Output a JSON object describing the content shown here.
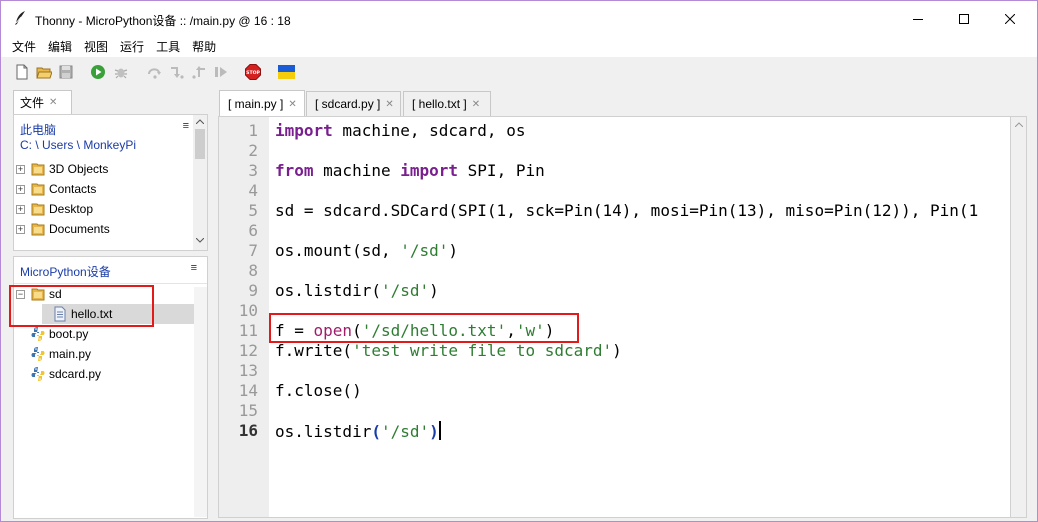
{
  "window": {
    "title": "Thonny  -  MicroPython设备 :: /main.py  @  16 : 18",
    "minimize_label": "minimize",
    "maximize_label": "maximize",
    "close_label": "close"
  },
  "menu": [
    "文件",
    "编辑",
    "视图",
    "运行",
    "工具",
    "帮助"
  ],
  "toolbar": {
    "icons": [
      "new-file-icon",
      "open-file-icon",
      "save-icon",
      "run-icon",
      "debug-icon",
      "step-over-icon",
      "step-into-icon",
      "step-out-icon",
      "resume-icon",
      "stop-icon",
      "ukraine-flag-icon"
    ]
  },
  "files_panel": {
    "tab_label": "文件",
    "this_pc": {
      "title": "此电脑",
      "path": "C: \\ Users \\ MonkeyPi",
      "items": [
        "3D Objects",
        "Contacts",
        "Desktop",
        "Documents"
      ]
    },
    "device": {
      "title": "MicroPython设备",
      "folder": "sd",
      "folder_child": "hello.txt",
      "files": [
        "boot.py",
        "main.py",
        "sdcard.py"
      ]
    }
  },
  "editor": {
    "tabs": [
      "[ main.py ]",
      "[ sdcard.py ]",
      "[ hello.txt ]"
    ],
    "line_numbers": [
      "1",
      "2",
      "3",
      "4",
      "5",
      "6",
      "7",
      "8",
      "9",
      "10",
      "11",
      "12",
      "13",
      "14",
      "15",
      "16"
    ],
    "current_line": 16,
    "code": {
      "l1_kw": "import",
      "l1_rest": " machine, sdcard, os",
      "l3_kw1": "from",
      "l3_mid": " machine ",
      "l3_kw2": "import",
      "l3_rest": " SPI, Pin",
      "l5": "sd = sdcard.SDCard(SPI(1, sck=Pin(14), mosi=Pin(13), miso=Pin(12)), Pin(1",
      "l7_a": "os.mount(sd, ",
      "l7_s": "'/sd'",
      "l7_b": ")",
      "l9_a": "os.listdir(",
      "l9_s": "'/sd'",
      "l9_b": ")",
      "l11_a": "f = ",
      "l11_bi": "open",
      "l11_b": "(",
      "l11_s1": "'/sd/hello.txt'",
      "l11_c": ",",
      "l11_s2": "'w'",
      "l11_d": ")",
      "l12_a": "f.write(",
      "l12_s": "'test write file to sdcard'",
      "l12_b": ")",
      "l14": "f.close()",
      "l16_a": "os.listdir",
      "l16_p1": "(",
      "l16_s": "'/sd'",
      "l16_p2": ")"
    }
  },
  "colors": {
    "keyword": "#7a1f8f",
    "string": "#2e7d32",
    "builtin": "#a01c6a",
    "highlight_box": "#e21a1a",
    "window_border": "#b48ad4"
  }
}
